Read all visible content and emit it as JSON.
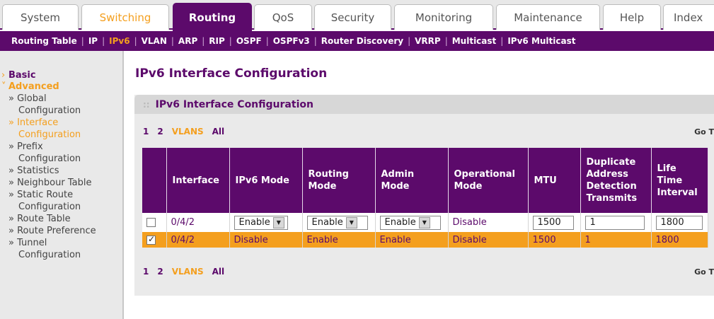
{
  "top_tabs": [
    {
      "label": "System"
    },
    {
      "label": "Switching"
    },
    {
      "label": "Routing"
    },
    {
      "label": "QoS"
    },
    {
      "label": "Security"
    },
    {
      "label": "Monitoring"
    },
    {
      "label": "Maintenance"
    },
    {
      "label": "Help"
    },
    {
      "label": "Index"
    }
  ],
  "subnav": [
    "Routing Table",
    "IP",
    "IPv6",
    "VLAN",
    "ARP",
    "RIP",
    "OSPF",
    "OSPFv3",
    "Router Discovery",
    "VRRP",
    "Multicast",
    "IPv6 Multicast"
  ],
  "sidebar": {
    "basic": "Basic",
    "advanced": "Advanced",
    "items": [
      {
        "line1": "» Global",
        "line2": "Configuration"
      },
      {
        "line1": "» Interface",
        "line2": "Configuration"
      },
      {
        "line1": "» Prefix",
        "line2": "Configuration"
      },
      {
        "line1": "» Statistics",
        "line2": ""
      },
      {
        "line1": "» Neighbour Table",
        "line2": ""
      },
      {
        "line1": "» Static Route",
        "line2": "Configuration"
      },
      {
        "line1": "» Route Table",
        "line2": ""
      },
      {
        "line1": "» Route Preference",
        "line2": ""
      },
      {
        "line1": "» Tunnel",
        "line2": "Configuration"
      }
    ]
  },
  "page_title": "IPv6 Interface Configuration",
  "panel_title": "IPv6 Interface Configuration",
  "pager": {
    "p1": "1",
    "p2": "2",
    "vlans": "VLANS",
    "all": "All",
    "goto": "Go T"
  },
  "table": {
    "headers": [
      "Interface",
      "IPv6 Mode",
      "Routing Mode",
      "Admin Mode",
      "Operational Mode",
      "MTU",
      "Duplicate Address Detection Transmits",
      "Life Time Interval"
    ],
    "edit_row": {
      "interface": "0/4/2",
      "ipv6_mode": "Enable",
      "routing_mode": "Enable",
      "admin_mode": "Enable",
      "operational_mode": "Disable",
      "mtu": "1500",
      "dad": "1",
      "life_time": "1800"
    },
    "rows": [
      {
        "interface": "0/4/2",
        "ipv6_mode": "Disable",
        "routing_mode": "Enable",
        "admin_mode": "Enable",
        "operational_mode": "Disable",
        "mtu": "1500",
        "dad": "1",
        "life_time": "1800",
        "checked": true
      }
    ]
  }
}
